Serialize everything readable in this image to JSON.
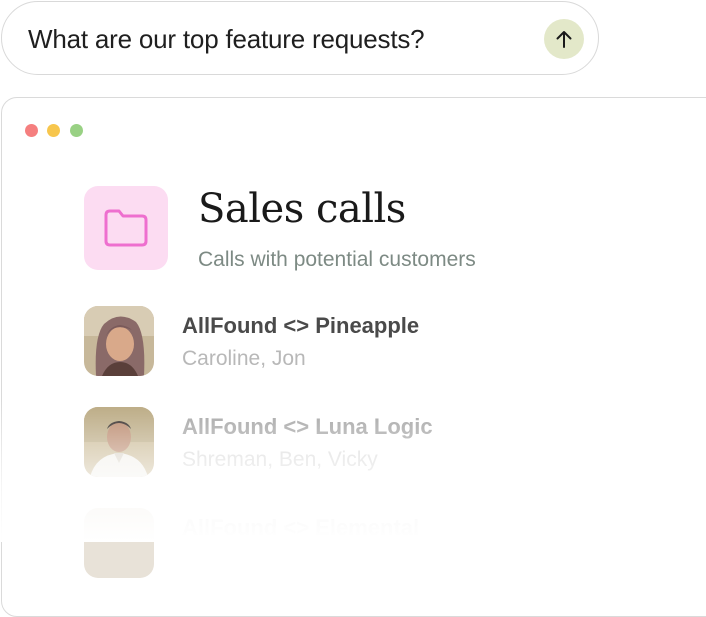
{
  "prompt": {
    "text": "What are our top feature requests?",
    "send_icon": "arrow-up-icon",
    "send_color": "#e3e8c9"
  },
  "window": {
    "controls": [
      "close",
      "minimize",
      "maximize"
    ],
    "folder_icon": "folder-icon",
    "folder_tile_color": "#fcdcf2",
    "title": "Sales calls",
    "subtitle": "Calls with potential customers",
    "calls": [
      {
        "title": "AllFound <> Pineapple",
        "people": "Caroline, Jon"
      },
      {
        "title": "AllFound <> Luna Logic",
        "people": "Shreman, Ben, Vicky"
      },
      {
        "title": "AllFound <> Elemental",
        "people": ""
      }
    ]
  }
}
